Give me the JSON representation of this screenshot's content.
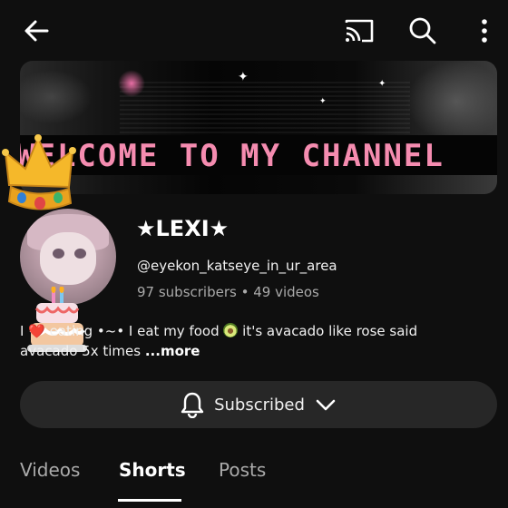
{
  "header": {
    "back_icon": "arrow-left-icon",
    "cast_icon": "cast-icon",
    "search_icon": "search-icon",
    "more_icon": "more-vert-icon"
  },
  "banner": {
    "text": "WELCOME TO MY CHANNEL",
    "text_color": "#f58cb0"
  },
  "channel": {
    "name": "★LEXI★",
    "handle": "@eyekon_katseye_in_ur_area",
    "stats": "97 subscribers • 49 videos",
    "description_line1": "I ❤️ eating  •~• I eat my food",
    "description_line1_end": "it's avacado like rose said",
    "description_line2": "avacado 5x times",
    "more_label": "...more"
  },
  "subscribe": {
    "label": "Subscribed",
    "bell_icon": "bell-icon",
    "chevron_icon": "chevron-down-icon"
  },
  "tabs": [
    {
      "label": "Videos",
      "active": false
    },
    {
      "label": "Shorts",
      "active": true
    },
    {
      "label": "Posts",
      "active": false
    }
  ]
}
